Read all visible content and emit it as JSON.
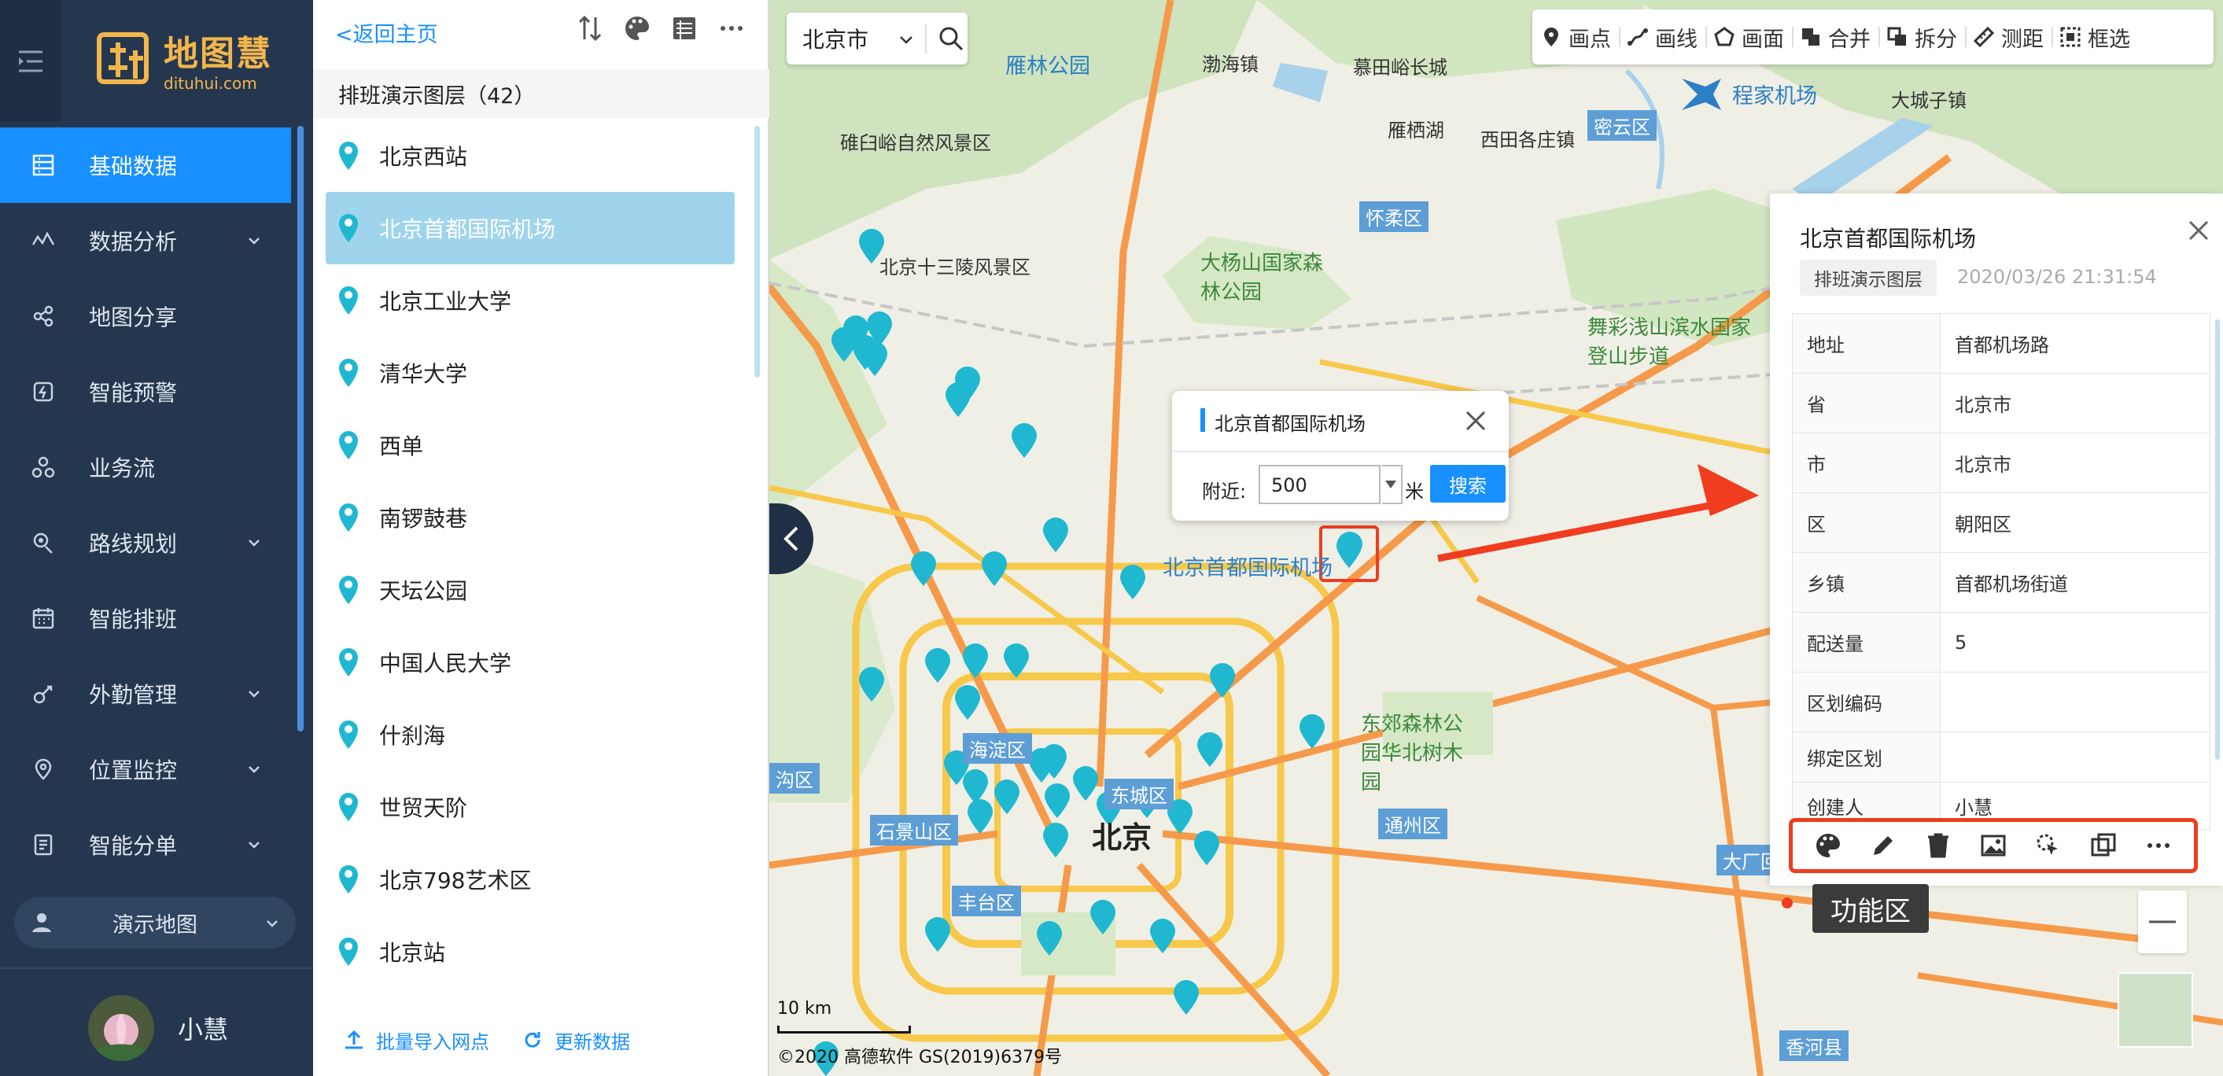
{
  "nav": {
    "logo_cn": "地图慧",
    "logo_en": "dituhui.com",
    "items": [
      {
        "label": "基础数据",
        "icon": "database-icon",
        "active": true,
        "expandable": false
      },
      {
        "label": "数据分析",
        "icon": "analysis-icon",
        "expandable": true
      },
      {
        "label": "地图分享",
        "icon": "share-icon",
        "expandable": false
      },
      {
        "label": "智能预警",
        "icon": "alarm-icon",
        "expandable": false
      },
      {
        "label": "业务流",
        "icon": "workflow-icon",
        "expandable": false
      },
      {
        "label": "路线规划",
        "icon": "route-icon",
        "expandable": true
      },
      {
        "label": "智能排班",
        "icon": "calendar-icon",
        "expandable": false
      },
      {
        "label": "外勤管理",
        "icon": "field-icon",
        "expandable": true
      },
      {
        "label": "位置监控",
        "icon": "location-icon",
        "expandable": true
      },
      {
        "label": "智能分单",
        "icon": "dispatch-icon",
        "expandable": true
      }
    ],
    "demo_map": "演示地图",
    "user_name": "小慧",
    "accent": "#1890ff"
  },
  "panel": {
    "back_link": "<返回主页",
    "group_title": "排班演示图层（42）",
    "items": [
      "北京西站",
      "北京首都国际机场",
      "北京工业大学",
      "清华大学",
      "西单",
      "南锣鼓巷",
      "天坛公园",
      "中国人民大学",
      "什刹海",
      "世贸天阶",
      "北京798艺术区",
      "北京站"
    ],
    "selected_index": 1,
    "import_label": "批量导入网点",
    "update_label": "更新数据"
  },
  "map": {
    "city": "北京市",
    "tools": [
      {
        "label": "画点",
        "icon": "pin-icon"
      },
      {
        "label": "画线",
        "icon": "line-icon"
      },
      {
        "label": "画面",
        "icon": "polygon-icon"
      },
      {
        "label": "合并",
        "icon": "merge-icon"
      },
      {
        "label": "拆分",
        "icon": "split-icon"
      },
      {
        "label": "测距",
        "icon": "ruler-icon"
      },
      {
        "label": "框选",
        "icon": "select-box-icon"
      }
    ],
    "labels": {
      "airport": "北京首都国际机场",
      "beijing": "北京",
      "haidian": "海淀区",
      "shijingshan": "石景山区",
      "fengtai": "丰台区",
      "dongcheng": "东城区",
      "tongzhou": "通州区",
      "huairou": "怀柔区",
      "miyun": "密云区",
      "daxing": "大厂回",
      "xianghe": "香河县",
      "mentougou": "沟区",
      "ming13": "北京十三陵风景区",
      "badaling": "慕田峪长城",
      "yanqi": "雁栖湖",
      "dayang": "大杨山国家森林公园",
      "wucai": "舞彩浅山滨水国家登山步道",
      "dongjiao": "东郊森林公园华北树木园",
      "bingjia": "程家机场",
      "shuangqiao": "碓臼峪自然风景区",
      "lin": "雁林公园",
      "shanzhen": "渤海镇",
      "xidao": "西田各庄镇",
      "langfu": "大城子镇"
    },
    "scale_label": "10 km",
    "copyright": "©2020 高德软件 GS(2019)6379号"
  },
  "popup": {
    "title": "北京首都国际机场",
    "near_label": "附近:",
    "radius_value": "500",
    "unit": "米",
    "search_label": "搜索"
  },
  "info": {
    "title": "北京首都国际机场",
    "layer_tag": "排班演示图层",
    "timestamp": "2020/03/26 21:31:54",
    "rows": [
      {
        "k": "地址",
        "v": "首都机场路"
      },
      {
        "k": "省",
        "v": "北京市"
      },
      {
        "k": "市",
        "v": "北京市"
      },
      {
        "k": "区",
        "v": "朝阳区"
      },
      {
        "k": "乡镇",
        "v": "首都机场街道"
      },
      {
        "k": "配送量",
        "v": "5"
      },
      {
        "k": "区划编码",
        "v": ""
      },
      {
        "k": "绑定区划",
        "v": ""
      },
      {
        "k": "创建人",
        "v": "小慧"
      }
    ],
    "function_tip": "功能区"
  }
}
